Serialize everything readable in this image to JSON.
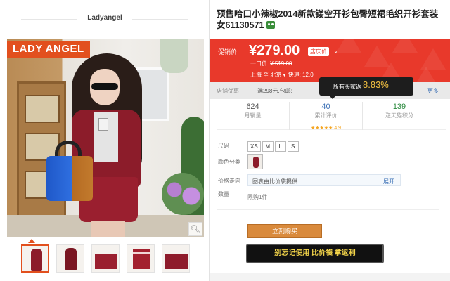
{
  "gallery": {
    "brand_name": "Ladyangel",
    "logo_text": "LADY ANGEL",
    "zoom_icon": "magnifier-icon",
    "thumbnails_count": 5
  },
  "product": {
    "title": "预售哈口小辣椒2014新款镂空开衫包臀短裙毛织开衫套装女61130571"
  },
  "promo": {
    "label": "促销价",
    "price": "¥279.00",
    "shop_badge": "店庆价",
    "one_price_label": "一口价",
    "one_price_value": "¥ 519.00",
    "ship_from": "上海",
    "ship_to_label": "至",
    "ship_to": "北京",
    "ship_speed": "快递: 12.0"
  },
  "coupon": {
    "label": "店铺优惠",
    "text": "满298元,包邮;",
    "more": "更多",
    "tip_label": "所有买家返",
    "tip_value": "8.83%"
  },
  "stats": {
    "monthly_sales": "624",
    "monthly_sales_label": "月销量",
    "reviews": "40",
    "reviews_label": "累计评价",
    "rating": "4.9",
    "points": "139",
    "points_label": "送天猫积分"
  },
  "options": {
    "size_label": "尺码",
    "sizes": [
      "XS",
      "M",
      "L",
      "S"
    ],
    "color_label": "颜色分类",
    "trend_label": "价格走向",
    "trend_text": "图表由比价袋提供",
    "trend_expand": "展开",
    "qty_label": "数量",
    "qty_limit": "限购1件"
  },
  "actions": {
    "buy_now": "立刻购买",
    "compare": "别忘记使用 比价袋 拿返利"
  },
  "colors": {
    "promo_red": "#e8392b",
    "brand_orange": "#e2501e",
    "buy_button": "#d98a3c",
    "compare_text": "#f3d44a"
  }
}
